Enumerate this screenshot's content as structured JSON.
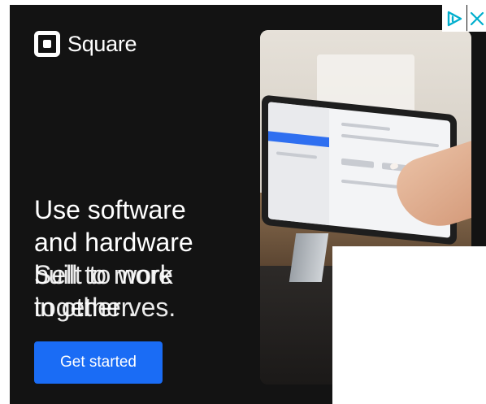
{
  "ad": {
    "brand": "Square",
    "headline_lines": [
      "Use software",
      "and hardware"
    ],
    "overlap_lines_a": [
      "Sell to more",
      "together."
    ],
    "overlap_lines_b": [
      "built to work",
      "in other ves."
    ],
    "cta_label": "Get started"
  },
  "icons": {
    "adchoices": "adchoices-icon",
    "close": "close-icon",
    "logo": "square-logo-icon"
  },
  "colors": {
    "background": "#131313",
    "cta": "#1a6cf5",
    "adchoices": "#00aecd"
  }
}
